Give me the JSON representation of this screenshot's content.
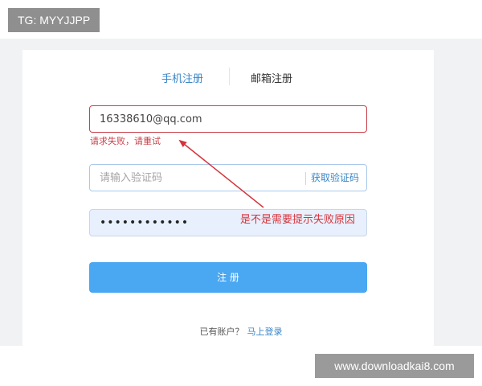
{
  "watermarks": {
    "top": "TG: MYYJJPP",
    "bottom": "www.downloadkai8.com"
  },
  "tabs": [
    {
      "label": "手机注册",
      "active": true
    },
    {
      "label": "邮箱注册",
      "active": false
    }
  ],
  "form": {
    "email_value": "16338610@qq.com",
    "error_message": "请求失败，请重试",
    "code_placeholder": "请输入验证码",
    "get_code_label": "获取验证码",
    "password_value": "••••••••••••",
    "submit_label": "注 册"
  },
  "annotation": {
    "text": "是不是需要提示失败原因"
  },
  "footer": {
    "prompt": "已有账户？",
    "login_link": "马上登录"
  },
  "colors": {
    "accent": "#4aa7f2",
    "link": "#3a86c8",
    "error": "#c9424a",
    "annotation": "#d6333a"
  }
}
